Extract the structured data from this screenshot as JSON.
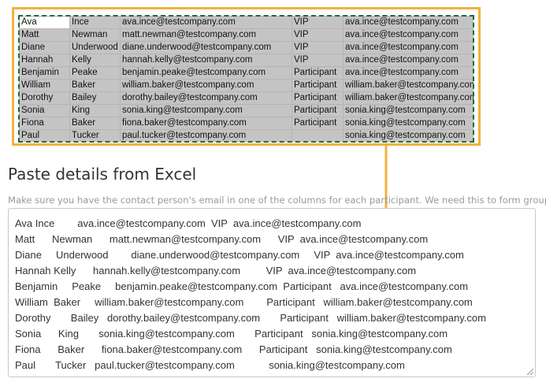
{
  "excel": {
    "rows": [
      [
        "Ava",
        "Ince",
        "ava.ince@testcompany.com",
        "VIP",
        "ava.ince@testcompany.com"
      ],
      [
        "Matt",
        "Newman",
        "matt.newman@testcompany.com",
        "VIP",
        "ava.ince@testcompany.com"
      ],
      [
        "Diane",
        "Underwood",
        "diane.underwood@testcompany.com",
        "VIP",
        "ava.ince@testcompany.com"
      ],
      [
        "Hannah",
        "Kelly",
        "hannah.kelly@testcompany.com",
        "VIP",
        "ava.ince@testcompany.com"
      ],
      [
        "Benjamin",
        "Peake",
        "benjamin.peake@testcompany.com",
        "Participant",
        "ava.ince@testcompany.com"
      ],
      [
        "William",
        "Baker",
        "william.baker@testcompany.com",
        "Participant",
        "william.baker@testcompany.com"
      ],
      [
        "Dorothy",
        "Bailey",
        "dorothy.bailey@testcompany.com",
        "Participant",
        "william.baker@testcompany.com"
      ],
      [
        "Sonia",
        "King",
        "sonia.king@testcompany.com",
        "Participant",
        "sonia.king@testcompany.com"
      ],
      [
        "Fiona",
        "Baker",
        "fiona.baker@testcompany.com",
        "Participant",
        "sonia.king@testcompany.com"
      ],
      [
        "Paul",
        "Tucker",
        "paul.tucker@testcompany.com",
        "",
        "sonia.king@testcompany.com"
      ]
    ]
  },
  "colors": {
    "frame_border": "#f2b23e",
    "sheet_fill": "#c4c4c4",
    "selection_border": "#1d6b3d",
    "title_text": "#333333",
    "hint_text": "#9a9a9a"
  },
  "icons": {
    "arrow": "arrow-down-icon",
    "grip": "resize-grip-icon"
  },
  "section": {
    "title": "Paste details from Excel",
    "hint": "Make sure you have the contact person's email in one of the columns for each participant. We need this to form groups."
  },
  "paste": {
    "lines": [
      "Ava Ince        ava.ince@testcompany.com  VIP  ava.ince@testcompany.com",
      "Matt      Newman      matt.newman@testcompany.com      VIP  ava.ince@testcompany.com",
      "Diane     Underwood        diane.underwood@testcompany.com     VIP  ava.ince@testcompany.com",
      "Hannah Kelly      hannah.kelly@testcompany.com         VIP  ava.ince@testcompany.com",
      "Benjamin     Peake     benjamin.peake@testcompany.com  Participant   ava.ince@testcompany.com",
      "William  Baker     william.baker@testcompany.com        Participant   william.baker@testcompany.com",
      "Dorothy       Bailey   dorothy.bailey@testcompany.com       Participant   william.baker@testcompany.com",
      "Sonia      King       sonia.king@testcompany.com       Participant   sonia.king@testcompany.com",
      "Fiona      Baker      fiona.baker@testcompany.com      Participant   sonia.king@testcompany.com",
      "Paul       Tucker   paul.tucker@testcompany.com            sonia.king@testcompany.com"
    ]
  }
}
